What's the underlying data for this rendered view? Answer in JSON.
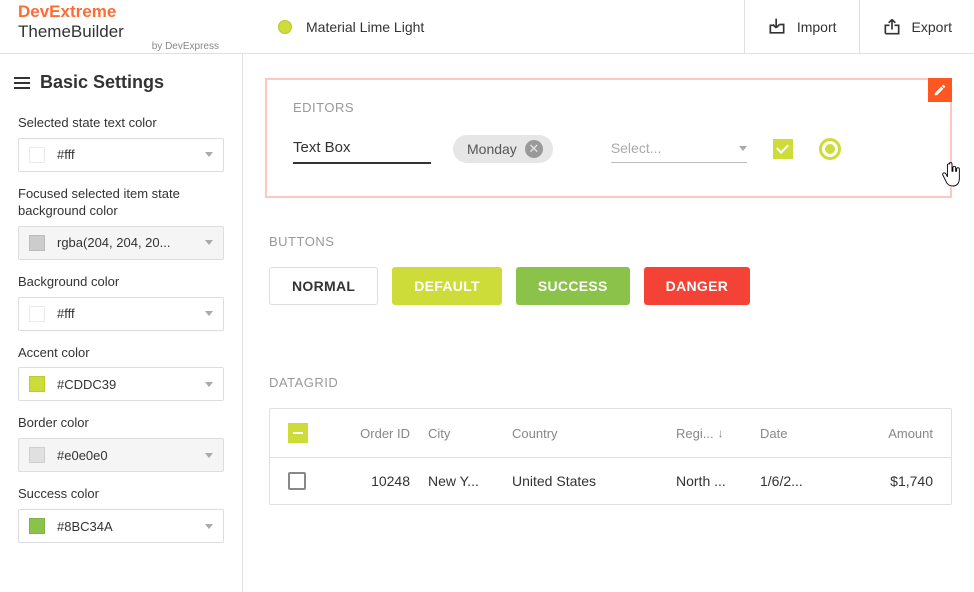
{
  "brand": {
    "dev": "DevExtreme",
    "builder": " ThemeBuilder",
    "sub": "by DevExpress"
  },
  "theme_name": "Material Lime Light",
  "actions": {
    "import": "Import",
    "export": "Export"
  },
  "sidebar_title": "Basic Settings",
  "settings": [
    {
      "label": "Selected state text color",
      "value": "#fff",
      "swatch": "white"
    },
    {
      "label": "Focused selected item state background color",
      "value": "rgba(204, 204, 20...",
      "swatch": "grey",
      "disabled": true
    },
    {
      "label": "Background color",
      "value": "#fff",
      "swatch": "white"
    },
    {
      "label": "Accent color",
      "value": "#CDDC39",
      "swatch": "lime"
    },
    {
      "label": "Border color",
      "value": "#e0e0e0",
      "swatch": "border",
      "disabled": true
    },
    {
      "label": "Success color",
      "value": "#8BC34A",
      "swatch": "green"
    }
  ],
  "sections": {
    "editors": "EDITORS",
    "buttons": "BUTTONS",
    "datagrid": "DATAGRID"
  },
  "editors": {
    "textbox": "Text Box",
    "tag": "Monday",
    "select_placeholder": "Select..."
  },
  "buttons": {
    "normal": "NORMAL",
    "default": "DEFAULT",
    "success": "SUCCESS",
    "danger": "DANGER"
  },
  "grid": {
    "headers": {
      "order_id": "Order ID",
      "city": "City",
      "country": "Country",
      "region": "Regi...",
      "date": "Date",
      "amount": "Amount"
    },
    "rows": [
      {
        "order_id": "10248",
        "city": "New Y...",
        "country": "United States",
        "region": "North ...",
        "date": "1/6/2...",
        "amount": "$1,740"
      }
    ]
  }
}
